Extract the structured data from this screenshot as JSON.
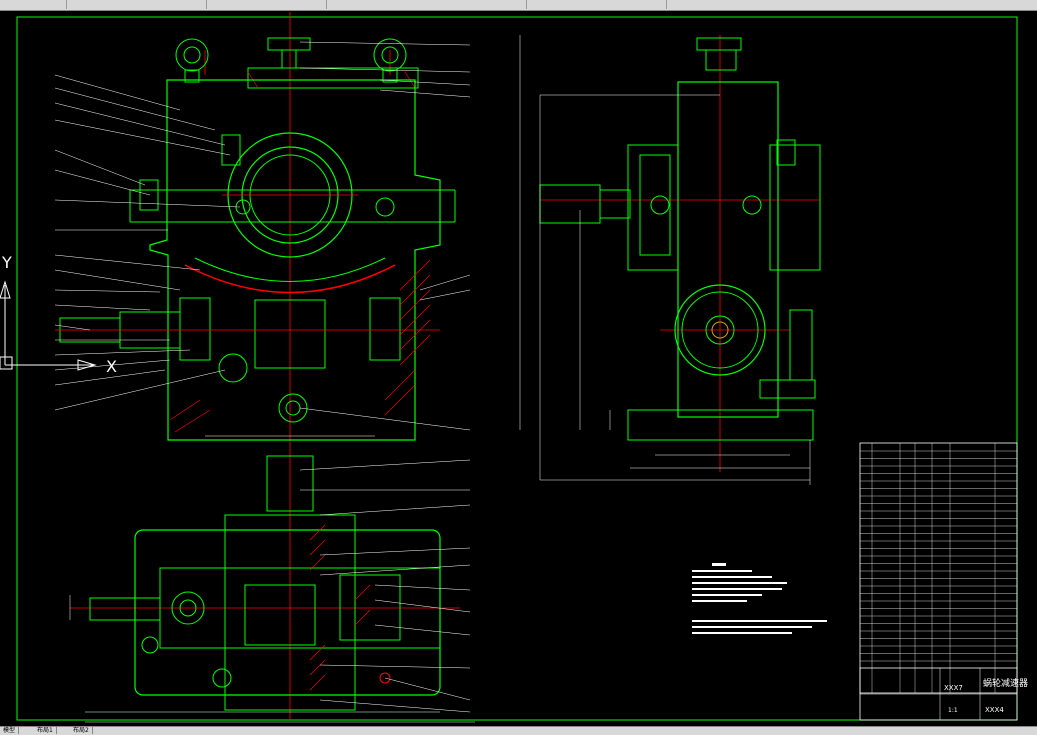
{
  "colors": {
    "background": "#000000",
    "outline": "#00ff00",
    "centerline": "#ff0000",
    "leader": "#ffffff",
    "dimension": "#ffffff",
    "hatch": "#ff0000",
    "gold": "#d4a017"
  },
  "ucs": {
    "y_label": "Y",
    "x_label": "X"
  },
  "title_block": {
    "left_code": "XXX7",
    "title": "蜗轮减速器",
    "drawing_no": "XXX4",
    "ratio": "1:1"
  },
  "bottom_tabs": [
    "模型",
    "布局1",
    "布局2"
  ],
  "ucs_icon_name": "ucs-icon"
}
